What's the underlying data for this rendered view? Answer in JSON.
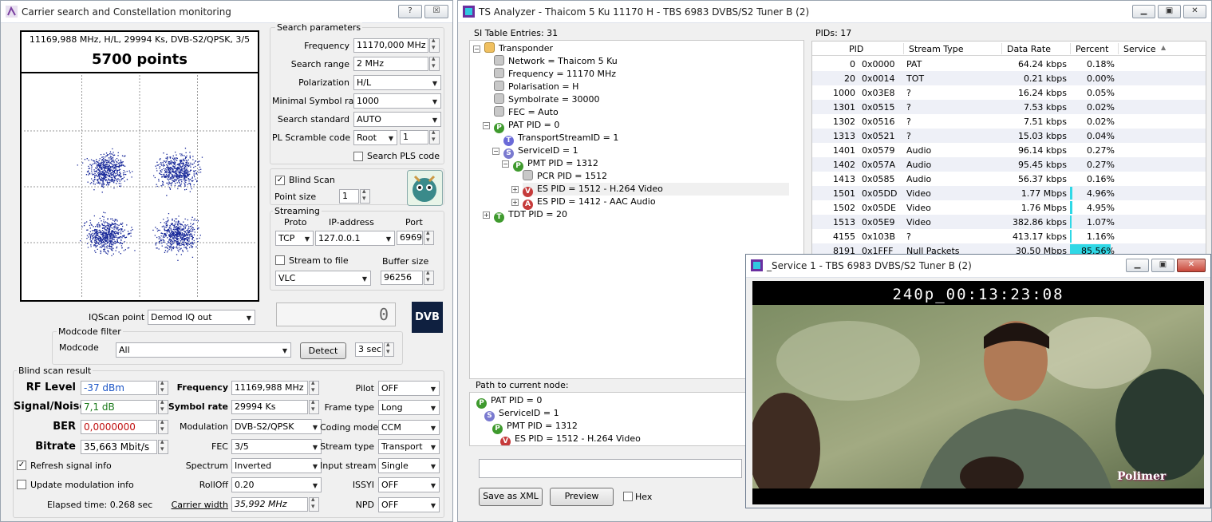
{
  "left_window": {
    "title": "Carrier search and Constellation monitoring",
    "help_label": "?",
    "close_label": "☒",
    "constellation": {
      "header": "11169,988 MHz, H/L, 29994 Ks, DVB-S2/QPSK, 3/5",
      "points_label": "5700 points",
      "points": 5700
    },
    "search_params": {
      "group_label": "Search parameters",
      "frequency_label": "Frequency",
      "frequency_value": "11170,000 MHz",
      "range_label": "Search range",
      "range_value": "2 MHz",
      "polarization_label": "Polarization",
      "polarization_value": "H/L",
      "min_symbol_label": "Minimal Symbol rate",
      "min_symbol_value": "1000",
      "standard_label": "Search standard",
      "standard_value": "AUTO",
      "pls_label": "PL Scramble code",
      "pls_mode": "Root",
      "pls_value": "1",
      "search_pls_label": "Search PLS code",
      "blind_scan_label": "Blind Scan",
      "point_size_label": "Point size",
      "point_size_value": "1"
    },
    "streaming": {
      "group_label": "Streaming",
      "proto_label": "Proto",
      "ip_label": "IP-address",
      "port_label": "Port",
      "proto_value": "TCP",
      "ip_value": "127.0.0.1",
      "port_value": "6969",
      "stream_to_file_label": "Stream to file",
      "buffer_label": "Buffer size",
      "player_value": "VLC",
      "buffer_value": "96256"
    },
    "iqscan_label": "IQScan point",
    "iqscan_value": "Demod IQ out",
    "counter_value": "0",
    "dvb_logo": "DVB",
    "modcode": {
      "group_label": "Modcode filter",
      "modcode_label": "Modcode",
      "modcode_value": "All",
      "detect_label": "Detect",
      "sec_value": "3 sec"
    },
    "blind_result": {
      "group_label": "Blind scan result",
      "rf_label": "RF Level",
      "rf_value": "-37 dBm",
      "snr_label": "Signal/Noise",
      "snr_value": "7,1 dB",
      "ber_label": "BER",
      "ber_value": "0,0000000",
      "bitrate_label": "Bitrate",
      "bitrate_value": "35,663 Mbit/s",
      "freq_label": "Frequency",
      "freq_value": "11169,988 MHz",
      "symrate_label": "Symbol rate",
      "symrate_value": "29994 Ks",
      "modulation_label": "Modulation",
      "modulation_value": "DVB-S2/QPSK",
      "fec_label": "FEC",
      "fec_value": "3/5",
      "spectrum_label": "Spectrum",
      "spectrum_value": "Inverted",
      "rolloff_label": "RollOff",
      "rolloff_value": "0.20",
      "carrier_width_label": "Carrier width",
      "carrier_width_value": "35,992 MHz",
      "pilot_label": "Pilot",
      "pilot_value": "OFF",
      "frame_label": "Frame type",
      "frame_value": "Long",
      "coding_label": "Coding mode",
      "coding_value": "CCM",
      "stype_label": "Stream type",
      "stype_value": "Transport",
      "istream_label": "Input stream",
      "istream_value": "Single",
      "issyi_label": "ISSYI",
      "issyi_value": "OFF",
      "npd_label": "NPD",
      "npd_value": "OFF",
      "refresh_label": "Refresh signal info",
      "update_mod_label": "Update modulation info",
      "elapsed": "Elapsed time: 0.268 sec"
    }
  },
  "ts_window": {
    "title": "TS Analyzer - Thaicom 5 Ku 11170 H - TBS 6983 DVBS/S2 Tuner B (2)",
    "si_label": "SI Table Entries: 31",
    "tree": [
      {
        "text": "Transponder",
        "icon": "folder-icon",
        "letter": ""
      },
      {
        "text": "Network = Thaicom 5 Ku",
        "icon": "gray-node-icon",
        "letter": ""
      },
      {
        "text": "Frequency = 11170 MHz",
        "icon": "gray-node-icon",
        "letter": ""
      },
      {
        "text": "Polarisation = H",
        "icon": "gray-node-icon",
        "letter": ""
      },
      {
        "text": "Symbolrate = 30000",
        "icon": "gray-node-icon",
        "letter": ""
      },
      {
        "text": "FEC = Auto",
        "icon": "gray-node-icon",
        "letter": ""
      },
      {
        "text": "PAT PID = 0",
        "icon": "p-icon",
        "letter": "P"
      },
      {
        "text": "TransportStreamID = 1",
        "icon": "t-icon",
        "letter": "T"
      },
      {
        "text": "ServiceID = 1",
        "icon": "s-icon",
        "letter": "S"
      },
      {
        "text": "PMT PID = 1312",
        "icon": "p-icon",
        "letter": "P"
      },
      {
        "text": "PCR PID = 1512",
        "icon": "gray-node-icon",
        "letter": ""
      },
      {
        "text": "ES PID = 1512 - H.264 Video",
        "icon": "v-icon",
        "letter": "V"
      },
      {
        "text": "ES PID = 1412 - AAC Audio",
        "icon": "a-icon",
        "letter": "A"
      },
      {
        "text": "TDT PID = 20",
        "icon": "t-icon",
        "letter": "T"
      }
    ],
    "path_label": "Path to current node:",
    "path": [
      {
        "text": "PAT PID = 0",
        "letter": "P"
      },
      {
        "text": "ServiceID = 1",
        "letter": "S"
      },
      {
        "text": "PMT PID = 1312",
        "letter": "P"
      },
      {
        "text": "ES PID = 1512 - H.264 Video",
        "letter": "V"
      }
    ],
    "save_xml_label": "Save as XML",
    "preview_label": "Preview",
    "hex_label": "Hex",
    "pids_label": "PIDs: 17",
    "columns": [
      "PID",
      "Stream Type",
      "Data Rate",
      "Percent",
      "Service"
    ],
    "rows": [
      [
        "0",
        "0x0000",
        "PAT",
        "64.24 kbps",
        "0.18%",
        0.18
      ],
      [
        "20",
        "0x0014",
        "TOT",
        "0.21 kbps",
        "0.00%",
        0.0
      ],
      [
        "1000",
        "0x03E8",
        "?",
        "16.24 kbps",
        "0.05%",
        0.05
      ],
      [
        "1301",
        "0x0515",
        "?",
        "7.53 kbps",
        "0.02%",
        0.02
      ],
      [
        "1302",
        "0x0516",
        "?",
        "7.51 kbps",
        "0.02%",
        0.02
      ],
      [
        "1313",
        "0x0521",
        "?",
        "15.03 kbps",
        "0.04%",
        0.04
      ],
      [
        "1401",
        "0x0579",
        "Audio",
        "96.14 kbps",
        "0.27%",
        0.27
      ],
      [
        "1402",
        "0x057A",
        "Audio",
        "95.45 kbps",
        "0.27%",
        0.27
      ],
      [
        "1413",
        "0x0585",
        "Audio",
        "56.37 kbps",
        "0.16%",
        0.16
      ],
      [
        "1501",
        "0x05DD",
        "Video",
        "1.77 Mbps",
        "4.96%",
        4.96
      ],
      [
        "1502",
        "0x05DE",
        "Video",
        "1.76 Mbps",
        "4.95%",
        4.95
      ],
      [
        "1513",
        "0x05E9",
        "Video",
        "382.86 kbps",
        "1.07%",
        1.07
      ],
      [
        "4155",
        "0x103B",
        "?",
        "413.17 kbps",
        "1.16%",
        1.16
      ],
      [
        "8191",
        "0x1FFF",
        "Null Packets",
        "30.50 Mbps",
        "85.56%",
        85.56
      ]
    ]
  },
  "video_window": {
    "title": "_Service 1 - TBS 6983 DVBS/S2 Tuner B (2)",
    "overlay": "240p_00:13:23:08",
    "logo": "Polimer"
  }
}
